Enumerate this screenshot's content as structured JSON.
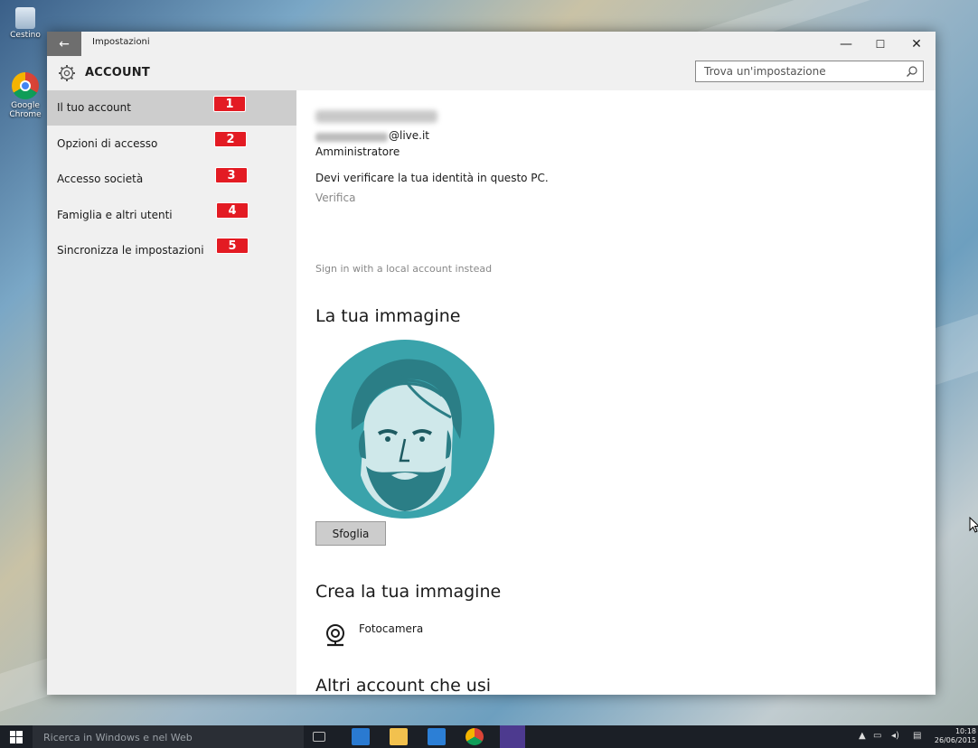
{
  "desktop": {
    "icons": [
      {
        "label": "Cestino"
      },
      {
        "label": "Google Chrome"
      }
    ]
  },
  "window": {
    "title": "Impostazioni",
    "back_glyph": "←",
    "minimize_glyph": "—",
    "maximize_glyph": "☐",
    "close_glyph": "✕"
  },
  "header": {
    "title": "ACCOUNT",
    "search_placeholder": "Trova un'impostazione"
  },
  "sidebar": {
    "items": [
      {
        "label": "Il tuo account",
        "badge": "1",
        "active": true
      },
      {
        "label": "Opzioni di accesso",
        "badge": "2",
        "active": false
      },
      {
        "label": "Accesso società",
        "badge": "3",
        "active": false
      },
      {
        "label": "Famiglia e altri utenti",
        "badge": "4",
        "active": false
      },
      {
        "label": "Sincronizza le impostazioni",
        "badge": "5",
        "active": false
      }
    ]
  },
  "account": {
    "email_suffix": "@live.it",
    "role": "Amministratore",
    "verify_message": "Devi verificare la tua identità in questo PC.",
    "verify_link": "Verifica",
    "local_account_link": "Sign in with a local account instead"
  },
  "picture_section": {
    "heading": "La tua immagine",
    "browse_button": "Sfoglia"
  },
  "create_section": {
    "heading": "Crea la tua immagine",
    "camera_label": "Fotocamera"
  },
  "other_accounts": {
    "heading": "Altri account che usi"
  },
  "taskbar": {
    "search_text": "Ricerca in Windows e nel Web",
    "clock_time": "10:18",
    "clock_date": "26/06/2015"
  },
  "colors": {
    "accent_badge": "#e31b23",
    "avatar_bg": "#3aa3ab",
    "sidebar_bg": "#f0f0f0",
    "sidebar_active": "#cdcdcd"
  }
}
